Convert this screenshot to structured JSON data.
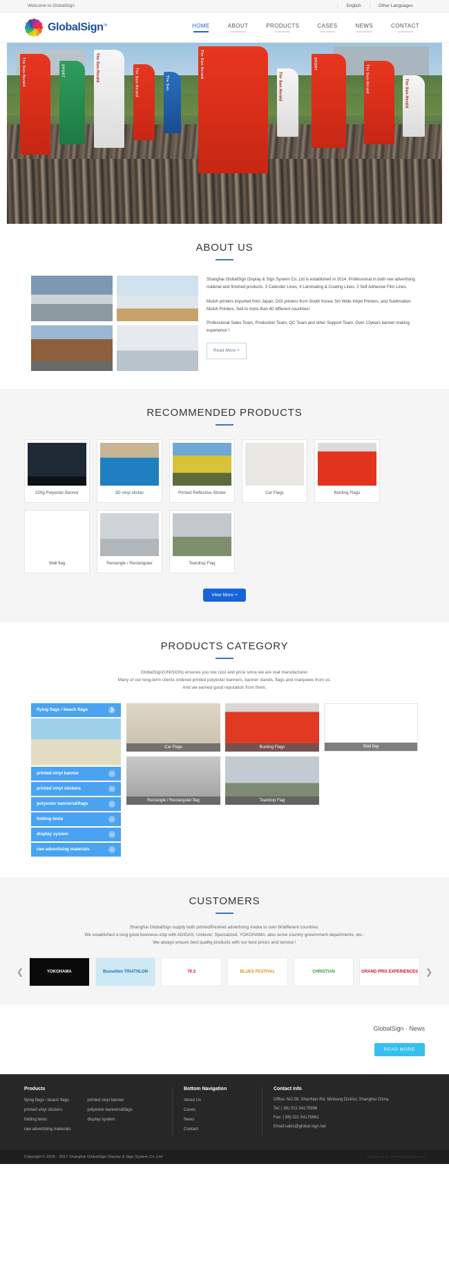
{
  "topbar": {
    "welcome": "Welcome to GlobalSign",
    "lang_en": "English",
    "lang_other": "Other Languages"
  },
  "header": {
    "brand": "GlobalSign",
    "brand_tm": "тм",
    "nav": [
      {
        "label": "HOME",
        "active": true
      },
      {
        "label": "ABOUT",
        "active": false
      },
      {
        "label": "PRODUCTS",
        "active": false
      },
      {
        "label": "CASES",
        "active": false
      },
      {
        "label": "NEWS",
        "active": false
      },
      {
        "label": "CONTACT",
        "active": false
      }
    ]
  },
  "hero": {
    "flags": [
      "The Sun-Herald",
      "SPORT",
      "The Sun-Herald",
      "The Sun-Herald",
      "The Sun",
      "The Sun-Herald"
    ]
  },
  "about": {
    "title": "ABOUT US",
    "p1": "Shanghai GlobalSign Display & Sign System Co.,Ltd is established in 2014. Professional in both raw advertising material and finished products. 3 Calender Lines, 4 Laminating & Coating Lines, 2 Self Adhesive Film Lines.",
    "p2": "Mutoh printers imported from Japan; DGI printers from South Korea; 5m Wide Inkjet Printers, and Sublimation Mutoh Printers. Sell to more than 60 different countries!",
    "p3": "Professional Sales Team, Production Team, QC Team and other Support Team. Over 12years banner making experience !",
    "read_more": "Read More +"
  },
  "recommended": {
    "title": "RECOMMENDED PRODUCTS",
    "products": [
      {
        "name": "220g Polyester Banner"
      },
      {
        "name": "3D vinyl sticker"
      },
      {
        "name": "Printed Reflective Sticker"
      },
      {
        "name": "Car Flags"
      },
      {
        "name": "Bunting Flags"
      },
      {
        "name": "Wall flag"
      },
      {
        "name": "Rectangle / Rectangular"
      },
      {
        "name": "Teardrop Flag"
      }
    ],
    "view_more": "View More +"
  },
  "category": {
    "title": "PRODUCTS CATEGORY",
    "sub1": "GlobalSign(UNISIGN) ensures you low cost and price since we are real manufacturer.",
    "sub2": "Many of our long-term clients ordered printed polyester banners, banner stands, flags and marquees from us.",
    "sub3": "And we earned good reputation from them.",
    "list": [
      {
        "label": "flying flags / beach flags",
        "icon": "chevron-right-icon"
      },
      {
        "label": "printed vinyl banner",
        "icon": "chevron-down-icon"
      },
      {
        "label": "printed vinyl stickers",
        "icon": "chevron-down-icon"
      },
      {
        "label": "polyester banners&flags",
        "icon": "chevron-down-icon"
      },
      {
        "label": "folding tents",
        "icon": "chevron-down-icon"
      },
      {
        "label": "display system",
        "icon": "chevron-down-icon"
      },
      {
        "label": "raw advertising materials",
        "icon": "chevron-down-icon"
      }
    ],
    "tiles": [
      {
        "caption": "Car Flags"
      },
      {
        "caption": "Bunting Flags"
      },
      {
        "caption": "Wall flag"
      },
      {
        "caption": "Rectangle / Rectangular flag"
      },
      {
        "caption": "Teardrop Flag"
      }
    ]
  },
  "customers": {
    "title": "CUSTOMERS",
    "sub1": "Shanghai GlobalSign supply both printed/finished advertising media to over 60different countries.",
    "sub2": "We established a long good business-ship with ADIDAS, Unilever, Specialized, YOKOHAMA, also some country government departments, etc..",
    "sub3": "We always ensure best quality products with our best prices and service !",
    "logos": [
      {
        "name": "YOKOHAMA"
      },
      {
        "name": "Busselton TRIATHLON"
      },
      {
        "name": "70.3"
      },
      {
        "name": "BLUES FESTIVAL"
      },
      {
        "name": "CHRISTIAN"
      },
      {
        "name": "GRAND PRIX EXPERIENCES"
      }
    ],
    "prev_icon": "chevron-left-icon",
    "next_icon": "chevron-right-icon"
  },
  "news": {
    "title": "GlobalSign · News",
    "button": "READ MORE"
  },
  "footer": {
    "products_head": "Products",
    "products_col1": [
      "flying flags / beach flags",
      "printed vinyl stickers",
      "folding tents",
      "raw advertising materials"
    ],
    "products_col2": [
      "printed vinyl banner",
      "polyester banners&flags",
      "display system"
    ],
    "nav_head": "Bottom Navigation",
    "nav_items": [
      "About Us",
      "Cases",
      "News",
      "Contact"
    ],
    "contact_head": "Contact Info",
    "office": "Office: NO.59, ShenNan Rd, Minhang District, Shanghai China.",
    "tel": "Tel: ( 86) 021 54179996",
    "fax": "Fax: ( 86) 021 54176661",
    "email": "Email:sales@global-sign.net",
    "copyright": "Copyright © 2016 - 2017 Shanghai GlobalSign Display & Sign System Co.,Ltd",
    "designed": "Designed by www.globalsign.net"
  },
  "colors": {
    "brand_blue": "#1b4f9c",
    "accent_blue": "#2065c8",
    "cat_blue": "#4aa3f0",
    "news_blue": "#35c0ef"
  }
}
